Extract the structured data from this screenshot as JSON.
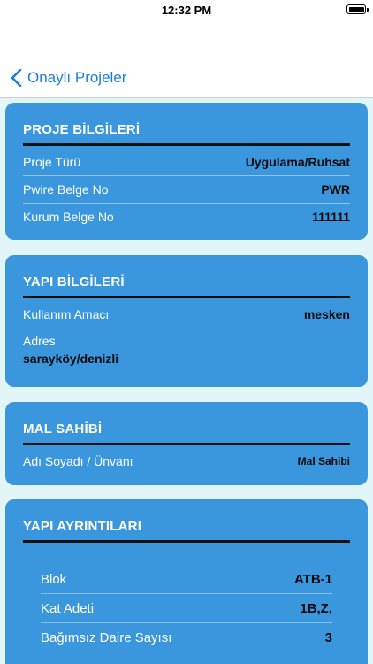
{
  "status_bar": {
    "time": "12:32 PM"
  },
  "nav": {
    "back_label": "Onaylı Projeler"
  },
  "proje": {
    "title": "PROJE BİLGİLERİ",
    "rows": [
      {
        "label": "Proje Türü",
        "value": "Uygulama/Ruhsat"
      },
      {
        "label": "Pwire Belge No",
        "value": "PWR"
      },
      {
        "label": "Kurum Belge No",
        "value": "111111"
      }
    ]
  },
  "yapi": {
    "title": "YAPI BİLGİLERİ",
    "kullanim_label": "Kullanım Amacı",
    "kullanim_value": "mesken",
    "adres_label": "Adres",
    "adres_value": "sarayköy/denizli"
  },
  "mal_sahibi": {
    "title": "MAL SAHİBİ",
    "label": "Adı Soyadı / Ünvanı",
    "value": "Mal Sahibi"
  },
  "ayrintilar": {
    "title": "YAPI AYRINTILARI",
    "rows": [
      {
        "label": "Blok",
        "value": "ATB-1"
      },
      {
        "label": "Kat Adeti",
        "value": "1B,Z,"
      },
      {
        "label": "Bağımsız Daire Sayısı",
        "value": "3"
      }
    ]
  }
}
